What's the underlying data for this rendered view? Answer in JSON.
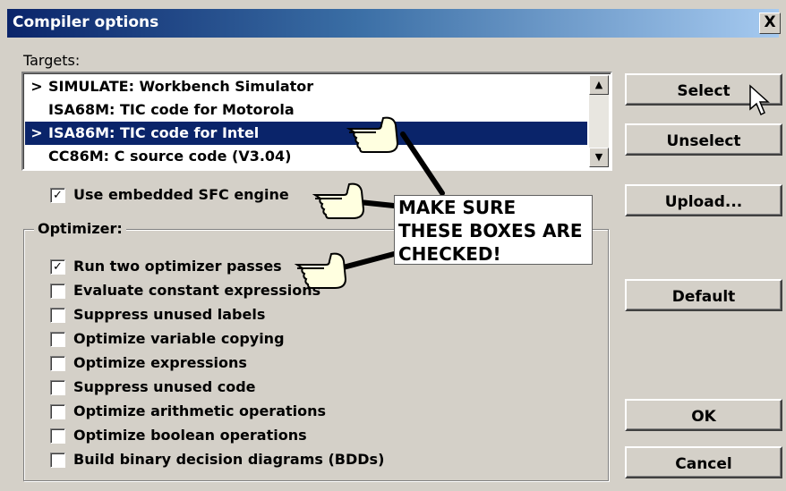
{
  "window": {
    "title": "Compiler options",
    "close_glyph": "X"
  },
  "targets": {
    "label": "Targets:",
    "items": [
      {
        "marker": ">",
        "text": "SIMULATE: Workbench Simulator",
        "selected": false
      },
      {
        "marker": "",
        "text": "ISA68M: TIC code for Motorola",
        "selected": false
      },
      {
        "marker": ">",
        "text": "ISA86M: TIC code for Intel",
        "selected": true
      },
      {
        "marker": "",
        "text": "CC86M: C source code (V3.04)",
        "selected": false
      }
    ]
  },
  "embedded_sfc": {
    "label": "Use embedded SFC engine",
    "checked": true
  },
  "optimizer": {
    "label": "Optimizer:",
    "options": [
      {
        "label": "Run two optimizer passes",
        "checked": true
      },
      {
        "label": "Evaluate constant expressions",
        "checked": false
      },
      {
        "label": "Suppress unused labels",
        "checked": false
      },
      {
        "label": "Optimize variable copying",
        "checked": false
      },
      {
        "label": "Optimize expressions",
        "checked": false
      },
      {
        "label": "Suppress unused code",
        "checked": false
      },
      {
        "label": "Optimize arithmetic operations",
        "checked": false
      },
      {
        "label": "Optimize boolean operations",
        "checked": false
      },
      {
        "label": "Build binary decision diagrams (BDDs)",
        "checked": false
      }
    ]
  },
  "buttons": {
    "select": "Select",
    "unselect": "Unselect",
    "upload": "Upload...",
    "default": "Default",
    "ok": "OK",
    "cancel": "Cancel"
  },
  "annotation": {
    "lines": [
      "MAKE SURE",
      "THESE BOXES ARE",
      "CHECKED!"
    ],
    "icons": [
      "pointing-hand-icon",
      "pointing-hand-icon",
      "pointing-hand-icon"
    ]
  },
  "colors": {
    "dialog_bg": "#d4d0c8",
    "title_start": "#0a246a",
    "title_end": "#a6caf0",
    "selection": "#0a246a"
  }
}
